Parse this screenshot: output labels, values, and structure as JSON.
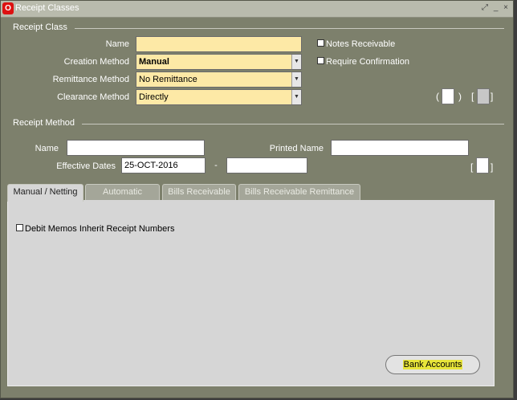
{
  "window": {
    "title": "Receipt Classes",
    "controls": [
      "⤢",
      "_",
      "×"
    ]
  },
  "receipt_class": {
    "section_label": "Receipt Class",
    "name_label": "Name",
    "name_value": "",
    "creation_method_label": "Creation Method",
    "creation_method_value": "Manual",
    "remittance_method_label": "Remittance Method",
    "remittance_method_value": "No Remittance",
    "clearance_method_label": "Clearance Method",
    "clearance_method_value": "Directly",
    "notes_receivable_label": "Notes Receivable",
    "notes_receivable_checked": false,
    "require_confirmation_label": "Require Confirmation",
    "require_confirmation_checked": false,
    "brackets": [
      "(",
      ")",
      "[",
      "]"
    ]
  },
  "receipt_method": {
    "section_label": "Receipt Method",
    "name_label": "Name",
    "name_value": "",
    "printed_name_label": "Printed Name",
    "printed_name_value": "",
    "effective_dates_label": "Effective Dates",
    "start_date": "25-OCT-2016",
    "date_separator": "-",
    "end_date": "",
    "brackets": [
      "[",
      "]"
    ]
  },
  "tabs": [
    {
      "label": "Manual / Netting",
      "active": true
    },
    {
      "label": "Automatic",
      "active": false
    },
    {
      "label": "Bills Receivable",
      "active": false
    },
    {
      "label": "Bills Receivable Remittance",
      "active": false
    }
  ],
  "panel": {
    "debit_memos_label": "Debit Memos Inherit Receipt Numbers",
    "debit_memos_checked": false,
    "bank_accounts_button": "Bank Accounts"
  },
  "colors": {
    "window_bg": "#7d806c",
    "required_field": "#fde9a6",
    "panel_bg": "#d6d6d6",
    "highlight": "#e8e53a"
  }
}
